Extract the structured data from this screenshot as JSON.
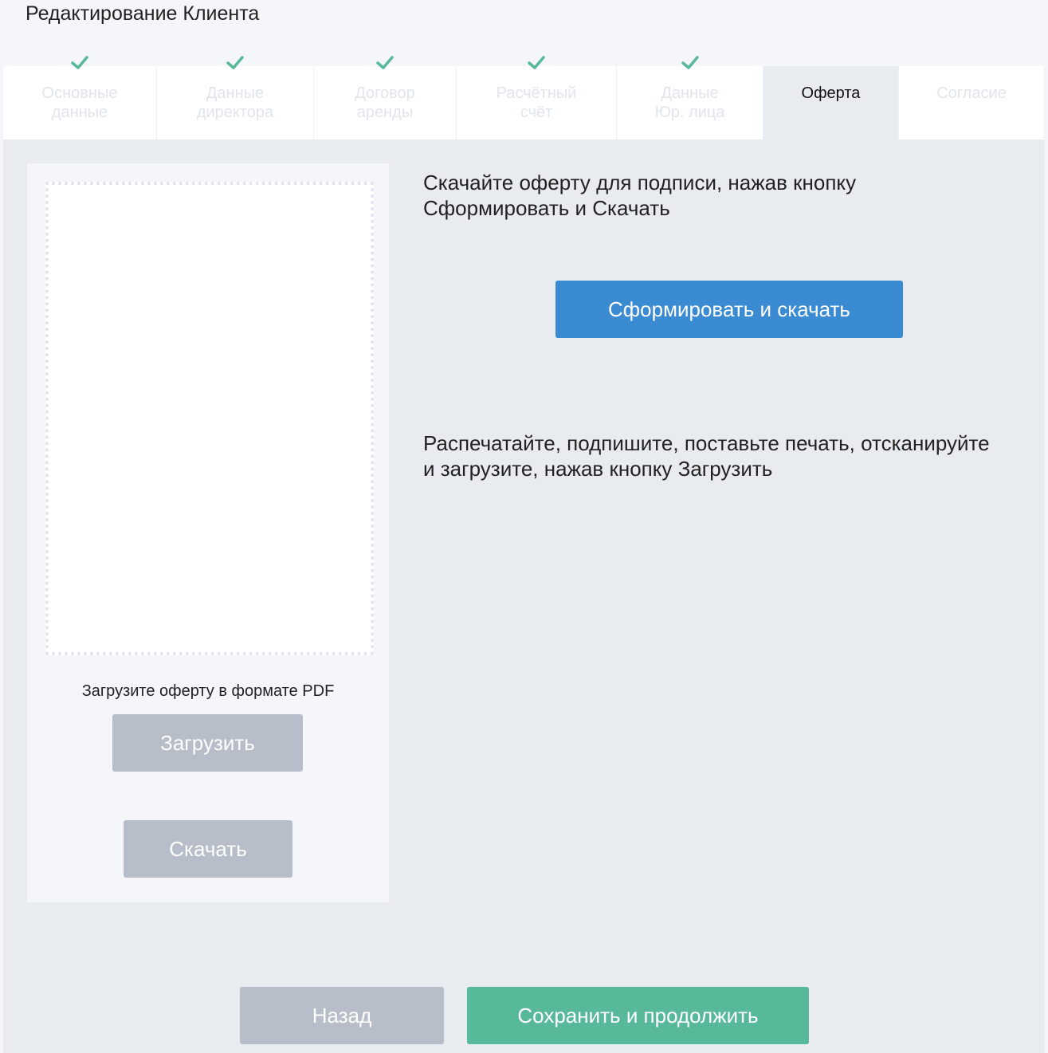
{
  "page": {
    "title": "Редактирование Клиента"
  },
  "tabs": [
    {
      "label": "Основные\nданные",
      "completed": true,
      "active": false
    },
    {
      "label": "Данные\nдиректора",
      "completed": true,
      "active": false
    },
    {
      "label": "Договор\nаренды",
      "completed": true,
      "active": false
    },
    {
      "label": "Расчётный\nсчёт",
      "completed": true,
      "active": false
    },
    {
      "label": "Данные\nЮр. лица",
      "completed": true,
      "active": false
    },
    {
      "label": "Оферта",
      "completed": false,
      "active": true
    },
    {
      "label": "Согласие",
      "completed": false,
      "active": false
    }
  ],
  "upload_panel": {
    "hint": "Загрузите оферту в формате PDF",
    "upload_label": "Загрузить",
    "download_label": "Скачать"
  },
  "instructions": {
    "step1": "Скачайте оферту для подписи, нажав кнопку\nСформировать и Скачать",
    "generate_label": "Сформировать и скачать",
    "step2": "Распечатайте, подпишите, поставьте печать, отсканируйте\nи загрузите, нажав кнопку Загрузить"
  },
  "footer": {
    "back_label": "Назад",
    "save_label": "Сохранить и продолжить"
  },
  "colors": {
    "check": "#58b99a",
    "primary_blue": "#3a8bd1",
    "success_green": "#58b99a",
    "disabled_gray": "#b7bec9"
  }
}
